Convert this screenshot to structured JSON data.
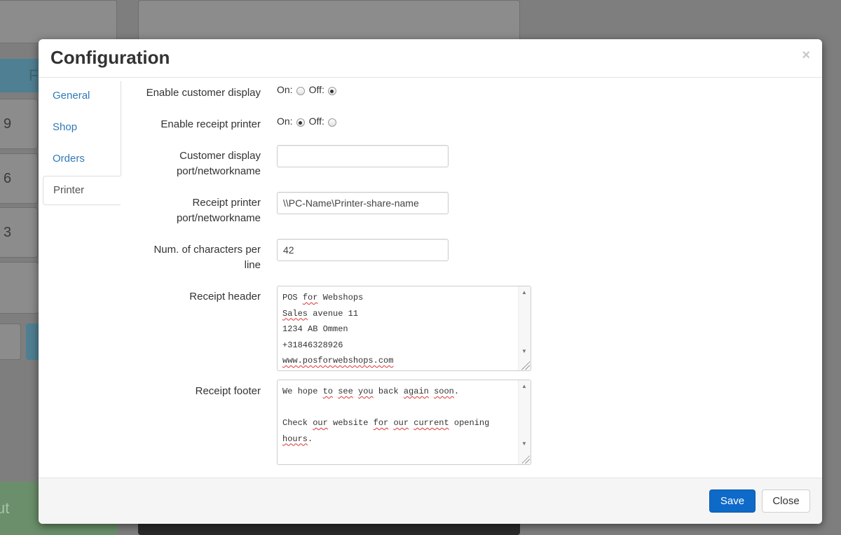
{
  "background": {
    "numpad": [
      "9",
      "6",
      "3"
    ],
    "left_button_fragment": "F",
    "checkout_fragment": "ut"
  },
  "modal": {
    "title": "Configuration",
    "close_glyph": "×",
    "tabs": [
      {
        "label": "General",
        "active": false
      },
      {
        "label": "Shop",
        "active": false
      },
      {
        "label": "Orders",
        "active": false
      },
      {
        "label": "Printer",
        "active": true
      }
    ],
    "fields": {
      "customer_display": {
        "label": "Enable customer display",
        "on_label": "On:",
        "off_label": "Off:",
        "value": "off"
      },
      "receipt_printer": {
        "label": "Enable receipt printer",
        "on_label": "On:",
        "off_label": "Off:",
        "value": "on"
      },
      "customer_display_port": {
        "label_line1": "Customer display",
        "label_line2": "port/networkname",
        "value": ""
      },
      "receipt_printer_port": {
        "label_line1": "Receipt printer",
        "label_line2": "port/networkname",
        "value": "\\\\PC-Name\\Printer-share-name"
      },
      "chars_per_line": {
        "label_line1": "Num. of characters per",
        "label_line2": "line",
        "value": "42"
      },
      "receipt_header": {
        "label": "Receipt header",
        "lines": [
          "POS for Webshops",
          "Sales avenue 11",
          "1234 AB Ommen",
          "+31846328926",
          "www.posforwebshops.com"
        ]
      },
      "receipt_footer": {
        "label": "Receipt footer",
        "lines": [
          "We hope to see you back again soon.",
          "",
          "Check our website for our current opening",
          "hours."
        ]
      }
    },
    "buttons": {
      "save": "Save",
      "close": "Close"
    },
    "colors": {
      "primary": "#0e6ac9",
      "link": "#2f7ab8"
    }
  }
}
